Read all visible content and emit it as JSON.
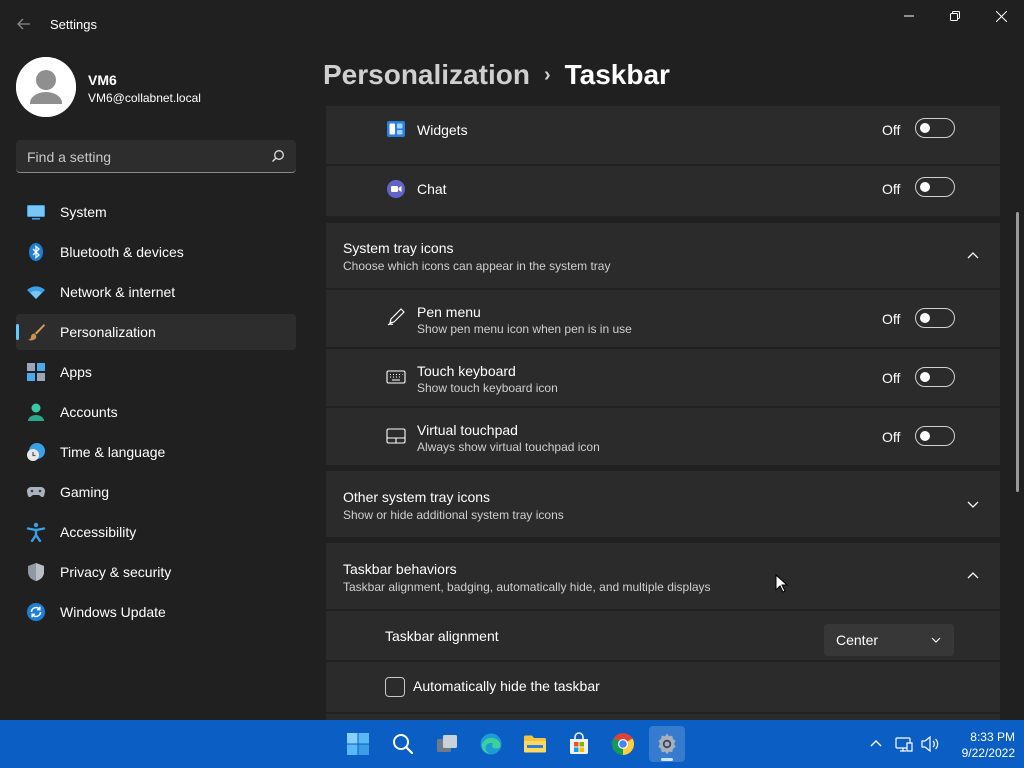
{
  "window": {
    "title": "Settings"
  },
  "user": {
    "name": "VM6",
    "email": "VM6@collabnet.local"
  },
  "search": {
    "placeholder": "Find a setting"
  },
  "nav": [
    {
      "label": "System",
      "icon": "system-icon"
    },
    {
      "label": "Bluetooth & devices",
      "icon": "bluetooth-icon"
    },
    {
      "label": "Network & internet",
      "icon": "wifi-icon"
    },
    {
      "label": "Personalization",
      "icon": "brush-icon",
      "active": true
    },
    {
      "label": "Apps",
      "icon": "apps-icon"
    },
    {
      "label": "Accounts",
      "icon": "accounts-icon"
    },
    {
      "label": "Time & language",
      "icon": "clock-globe-icon"
    },
    {
      "label": "Gaming",
      "icon": "gamepad-icon"
    },
    {
      "label": "Accessibility",
      "icon": "accessibility-icon"
    },
    {
      "label": "Privacy & security",
      "icon": "shield-icon"
    },
    {
      "label": "Windows Update",
      "icon": "update-icon"
    }
  ],
  "breadcrumb": {
    "parent": "Personalization",
    "separator": "›",
    "current": "Taskbar"
  },
  "taskbar_items": {
    "widgets": {
      "label": "Widgets",
      "state": "Off",
      "on": false
    },
    "chat": {
      "label": "Chat",
      "state": "Off",
      "on": false
    }
  },
  "system_tray": {
    "title": "System tray icons",
    "subtitle": "Choose which icons can appear in the system tray",
    "items": {
      "pen": {
        "title": "Pen menu",
        "subtitle": "Show pen menu icon when pen is in use",
        "state": "Off",
        "on": false
      },
      "keyboard": {
        "title": "Touch keyboard",
        "subtitle": "Show touch keyboard icon",
        "state": "Off",
        "on": false
      },
      "touchpad": {
        "title": "Virtual touchpad",
        "subtitle": "Always show virtual touchpad icon",
        "state": "Off",
        "on": false
      }
    }
  },
  "other_tray": {
    "title": "Other system tray icons",
    "subtitle": "Show or hide additional system tray icons"
  },
  "behaviors": {
    "title": "Taskbar behaviors",
    "subtitle": "Taskbar alignment, badging, automatically hide, and multiple displays",
    "alignment_label": "Taskbar alignment",
    "alignment_value": "Center",
    "autohide_label": "Automatically hide the taskbar",
    "autohide_checked": false
  },
  "taskbar": {
    "apps": [
      "start-icon",
      "search-icon",
      "task-view-icon",
      "edge-icon",
      "file-explorer-icon",
      "store-icon",
      "chrome-icon",
      "settings-icon"
    ],
    "active_app": "settings-icon",
    "time": "8:33 PM",
    "date": "9/22/2022"
  },
  "colors": {
    "accent": "#60cdff",
    "taskbar": "#0b5ec4",
    "background": "#202020",
    "card": "#2b2b2b"
  }
}
